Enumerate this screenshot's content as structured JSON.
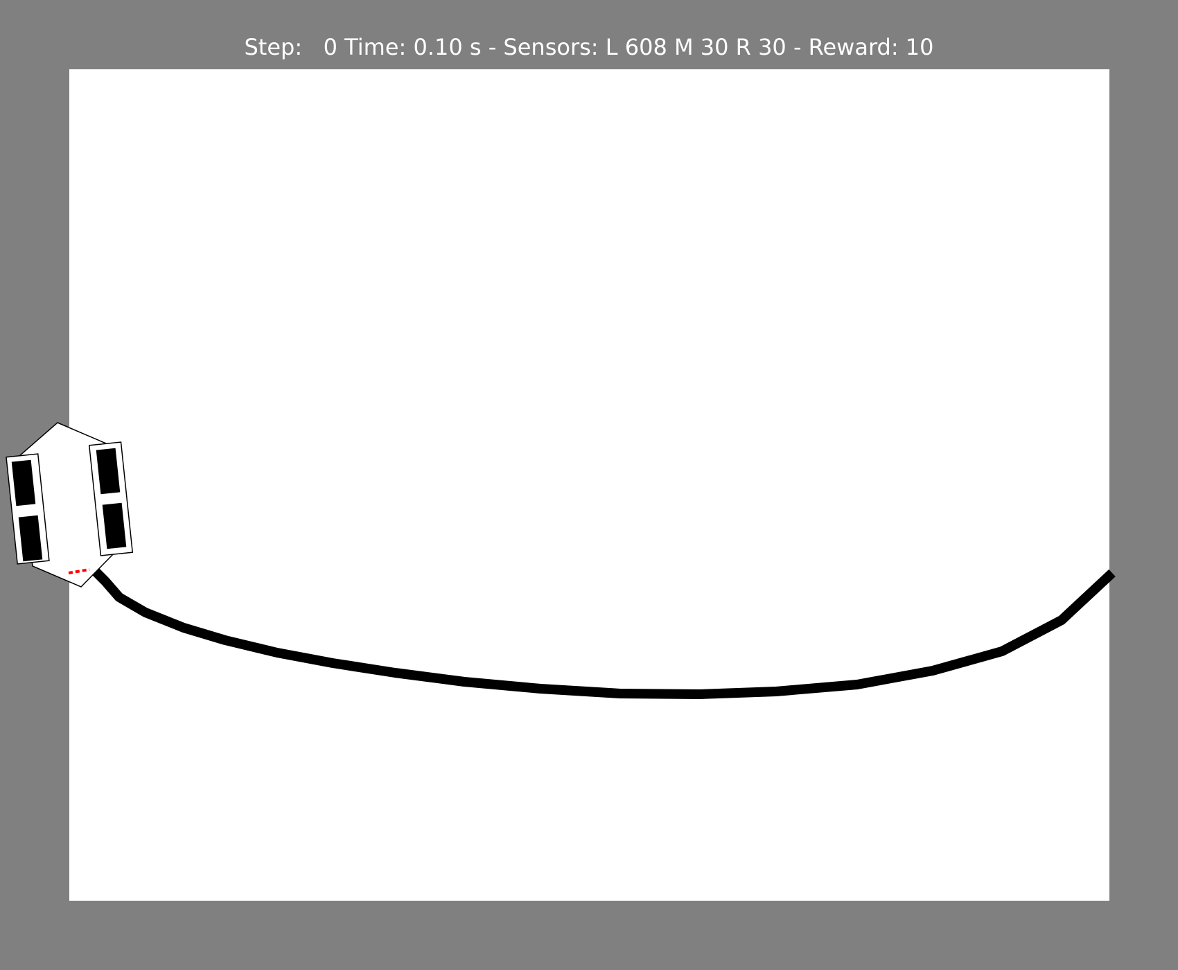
{
  "window": {
    "background_color": "#808080",
    "arena_color": "#ffffff"
  },
  "hud": {
    "step_label": "Step:",
    "step_value": "0",
    "time_label": "Time:",
    "time_value": "0.10 s",
    "sensors_label": "Sensors:",
    "sensor_left": "L 608",
    "sensor_middle": "M 30",
    "sensor_right": "R 30",
    "reward_label": "Reward:",
    "reward_value": "10",
    "separator": "-"
  },
  "scene": {
    "track_color": "#000000",
    "robot_body_color": "#ffffff",
    "robot_outline_color": "#000000",
    "wheel_color": "#000000",
    "sensor_ray_color": "#ff0000"
  }
}
